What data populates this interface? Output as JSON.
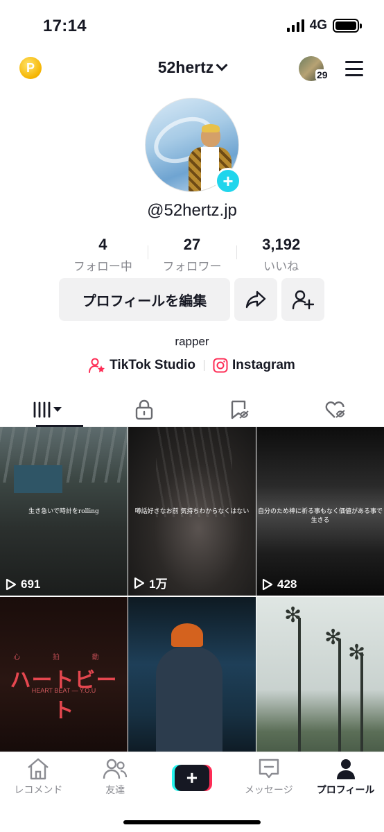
{
  "status": {
    "time": "17:14",
    "network": "4G"
  },
  "header": {
    "username": "52hertz",
    "friend_count": "29",
    "coin_symbol": "P"
  },
  "profile": {
    "handle": "@52hertz.jp",
    "stats": [
      {
        "value": "4",
        "label": "フォロー中"
      },
      {
        "value": "27",
        "label": "フォロワー"
      },
      {
        "value": "3,192",
        "label": "いいね"
      }
    ],
    "edit_button": "プロフィールを編集",
    "bio": "rapper",
    "links": [
      {
        "label": "TikTok Studio",
        "icon": "person-star-icon"
      },
      {
        "label": "Instagram",
        "icon": "instagram-icon"
      }
    ]
  },
  "tabs": [
    {
      "icon": "videos-grid-icon",
      "active": true
    },
    {
      "icon": "lock-icon",
      "active": false
    },
    {
      "icon": "saved-icon",
      "active": false
    },
    {
      "icon": "liked-icon",
      "active": false
    }
  ],
  "videos": [
    {
      "caption": "生き急いで時計をrolling",
      "views": "691"
    },
    {
      "caption": "噂話好きなお前 気持ちわからなくはない",
      "views": "1万"
    },
    {
      "caption": "自分のため神に祈る事もなく価値がある事で生きる",
      "views": "428"
    },
    {
      "caption_top": "心 拍 動",
      "caption_title": "ハートビート",
      "caption_sub": "HEART BEAT — Y.O.U",
      "views": ""
    },
    {
      "caption": "",
      "views": ""
    },
    {
      "caption": "",
      "views": ""
    }
  ],
  "nav": [
    {
      "label": "レコメンド",
      "icon": "home-icon"
    },
    {
      "label": "友達",
      "icon": "friends-icon"
    },
    {
      "label": "",
      "icon": "plus-icon"
    },
    {
      "label": "メッセージ",
      "icon": "message-icon"
    },
    {
      "label": "プロフィール",
      "icon": "profile-icon"
    }
  ],
  "colors": {
    "accent": "#fe2c55",
    "cyan": "#25f4ee",
    "add_button": "#20d5ec",
    "coin": "#f5b400"
  }
}
